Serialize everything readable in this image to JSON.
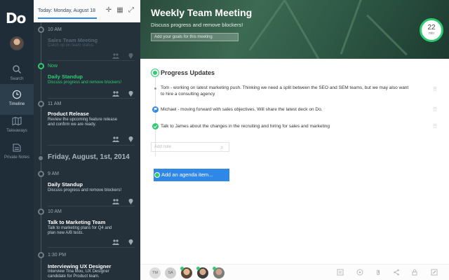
{
  "app": {
    "logo_text": "Do"
  },
  "rail": {
    "items": [
      {
        "label": "Search",
        "icon": "search-icon"
      },
      {
        "label": "Timeline",
        "icon": "clock-icon",
        "active": true
      },
      {
        "label": "Takeaways",
        "icon": "map-icon"
      },
      {
        "label": "Private Notes",
        "icon": "lock-icon"
      }
    ]
  },
  "timeline": {
    "header_date": "Today: Monday, August 18",
    "items": [
      {
        "time": "10 AM",
        "title": "Sales Team Meeting",
        "desc": "Catch up on team status.",
        "state": "past"
      },
      {
        "time": "Now",
        "title": "Daily Standup",
        "desc": "Discuss progress and remove blockers!",
        "state": "now"
      },
      {
        "time": "11 AM",
        "title": "Product Release",
        "desc": "Review the upcoming feature release and confirm we are ready.",
        "state": "future"
      }
    ],
    "day_label": "Friday, August, 1st, 2014",
    "items2": [
      {
        "time": "9 AM",
        "title": "Daily Standup",
        "desc": "Discuss progress and remove blockers!"
      },
      {
        "time": "10 AM",
        "title": "Talk to Marketing Team",
        "desc": "Talk to marketing plans for Q4 and plan new A/B tests."
      },
      {
        "time": "1:30 PM",
        "title": "Interviewing UX Designer",
        "desc": "Interview Tina Mou, UX Designer candidate for Product team."
      }
    ]
  },
  "meeting": {
    "title": "Weekly Team Meeting",
    "subtitle": "Discuss progress and remove blockers!",
    "goals_placeholder": "Add your goals for this meeting",
    "timer_value": "22",
    "timer_unit": "min",
    "section_title": "Progress Updates",
    "notes": [
      {
        "text": "Tom - working on latest marketing push. Thinking we need a split between the SEO and SEM teams, but we may also want to hire a consulting agency",
        "mark": "bullet"
      },
      {
        "text": "Michael - moving forward with sales objectives. Will share the latest deck on Do.",
        "mark": "flag"
      },
      {
        "text": "Talk to James about the changes in the recruiting and hiring for sales and marketing",
        "mark": "check"
      }
    ],
    "add_note_placeholder": "Add note",
    "add_agenda_label": "Add an agenda item...",
    "attendees": [
      {
        "initials": "TM",
        "online": false
      },
      {
        "initials": "SA",
        "online": false
      },
      {
        "initials": "",
        "online": true
      },
      {
        "initials": "",
        "online": true
      },
      {
        "initials": "",
        "online": true
      }
    ]
  },
  "colors": {
    "accent_green": "#2ecc71",
    "accent_blue": "#2f88e8",
    "sidebar_dark": "#24313b"
  }
}
